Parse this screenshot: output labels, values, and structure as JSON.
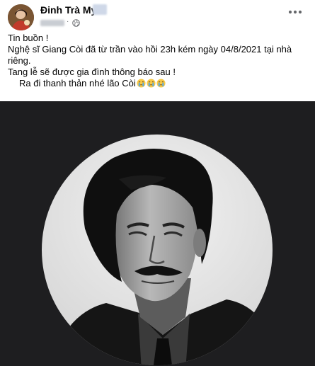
{
  "post": {
    "author": "Đinh Trà My",
    "privacy_icon": "globe-icon",
    "more_icon": "ellipsis-icon",
    "lines": [
      "Tin buồn !",
      "Nghệ sĩ Giang Còi đã từ trần vào hồi 23h kém ngày 04/8/2021 tại nhà riêng.",
      "Tang lễ sẽ được gia đình thông báo sau !",
      "Ra đi thanh thản nhé lão Còi"
    ],
    "emoji": [
      "crying-face-emoji",
      "crying-face-emoji",
      "crying-face-emoji"
    ]
  },
  "colors": {
    "text": "#050505",
    "secondary": "#65676b",
    "photo_background": "#1e1e20"
  }
}
